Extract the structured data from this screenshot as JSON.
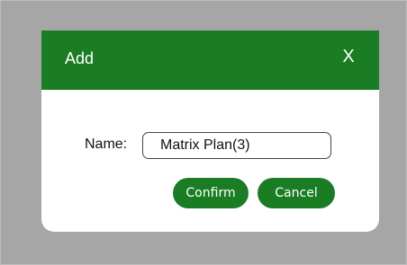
{
  "dialog": {
    "title": "Add",
    "close_label": "X"
  },
  "form": {
    "name_label": "Name:",
    "name_value": "Matrix Plan(3)"
  },
  "buttons": {
    "confirm_label": "Confirm",
    "cancel_label": "Cancel"
  },
  "colors": {
    "accent": "#1a7d24",
    "overlay": "#a6a6a6",
    "dialog_background": "#ffffff"
  }
}
